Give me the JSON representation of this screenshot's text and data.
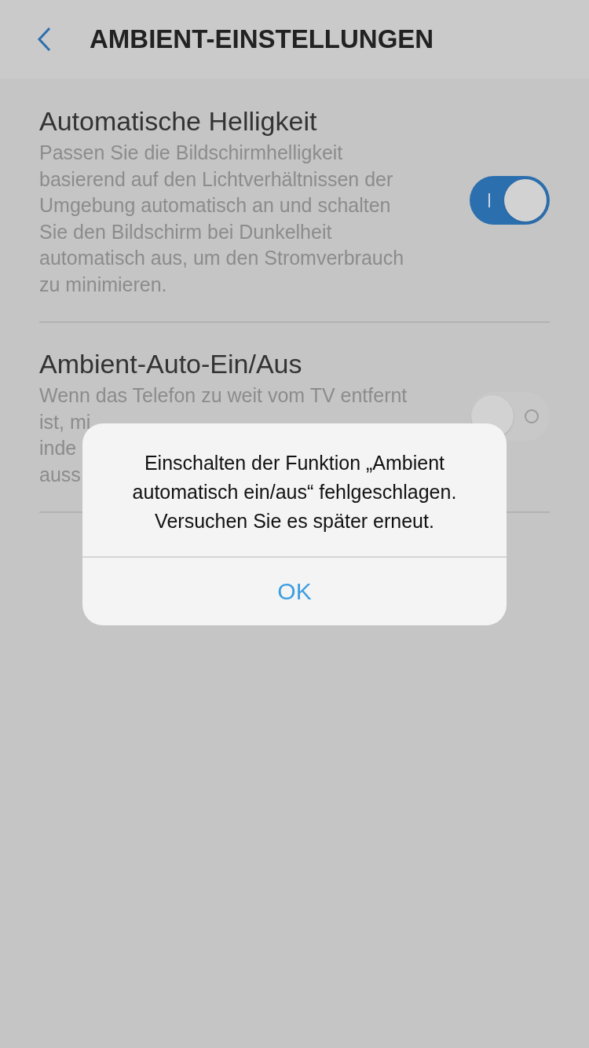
{
  "header": {
    "title": "AMBIENT-EINSTELLUNGEN"
  },
  "settings": [
    {
      "title": "Automatische Helligkeit",
      "description_lines": [
        "Passen Sie die Bildschirmhelligkeit",
        "basierend auf den Lichtverhältnissen der",
        "Umgebung automatisch an und schalten",
        "Sie den Bildschirm bei Dunkelheit",
        "automatisch aus, um den Stromverbrauch",
        "zu minimieren."
      ],
      "on": true
    },
    {
      "title": "Ambient-Auto-Ein/Aus",
      "description_lines": [
        "Wenn das Telefon zu weit vom TV entfernt",
        "ist, mi",
        "inde",
        "auss"
      ],
      "on": false
    }
  ],
  "dialog": {
    "message": "Einschalten der Funktion „Ambient automatisch ein/aus“ fehlgeschlagen. Versuchen Sie es später erneut.",
    "button": "OK"
  }
}
